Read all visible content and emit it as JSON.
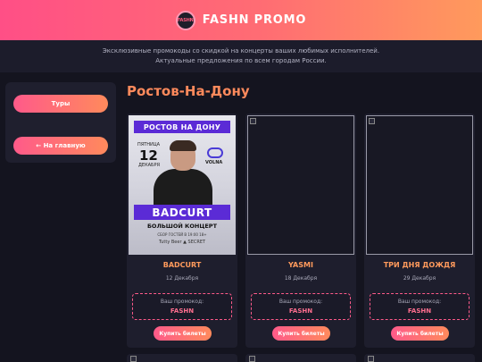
{
  "header": {
    "brand": "FASHN PROMO",
    "logo_text": "FASHN"
  },
  "intro": {
    "line1": "Эксклюзивные промокоды со скидкой на концерты ваших любимых исполнителей.",
    "line2": "Актуальные предложения по всем городам России."
  },
  "sidebar": {
    "tours_label": "Туры",
    "home_label": "← На главную"
  },
  "city": "Ростов-На-Дону",
  "poster": {
    "title": "РОСТОВ НА ДОНУ",
    "day": "ПЯТНИЦА",
    "num": "12",
    "month": "ДЕКАБРЯ",
    "venue": "VOLNA",
    "artist": "BADCURT",
    "sub": "БОЛЬШОЙ КОНЦЕРТ",
    "small": "СБОР ГОСТЕЙ В 19:00   18+",
    "logos": "Tutty Beer   ▲   SECRET"
  },
  "cards": [
    {
      "name": "BADCURT",
      "date": "12 Декабря",
      "promo_label": "Ваш промокод:",
      "promo_code": "FASHN",
      "buy_label": "Купить билеты"
    },
    {
      "name": "YASMI",
      "date": "18 Декабря",
      "promo_label": "Ваш промокод:",
      "promo_code": "FASHN",
      "buy_label": "Купить билеты"
    },
    {
      "name": "ТРИ ДНЯ ДОЖДЯ",
      "date": "29 Декабря",
      "promo_label": "Ваш промокод:",
      "promo_code": "FASHN",
      "buy_label": "Купить билеты"
    }
  ],
  "colors": {
    "accent": "#ff5a8a",
    "accent2": "#ff8a5c",
    "bg": "#14141f",
    "card": "#1e1e2d"
  }
}
